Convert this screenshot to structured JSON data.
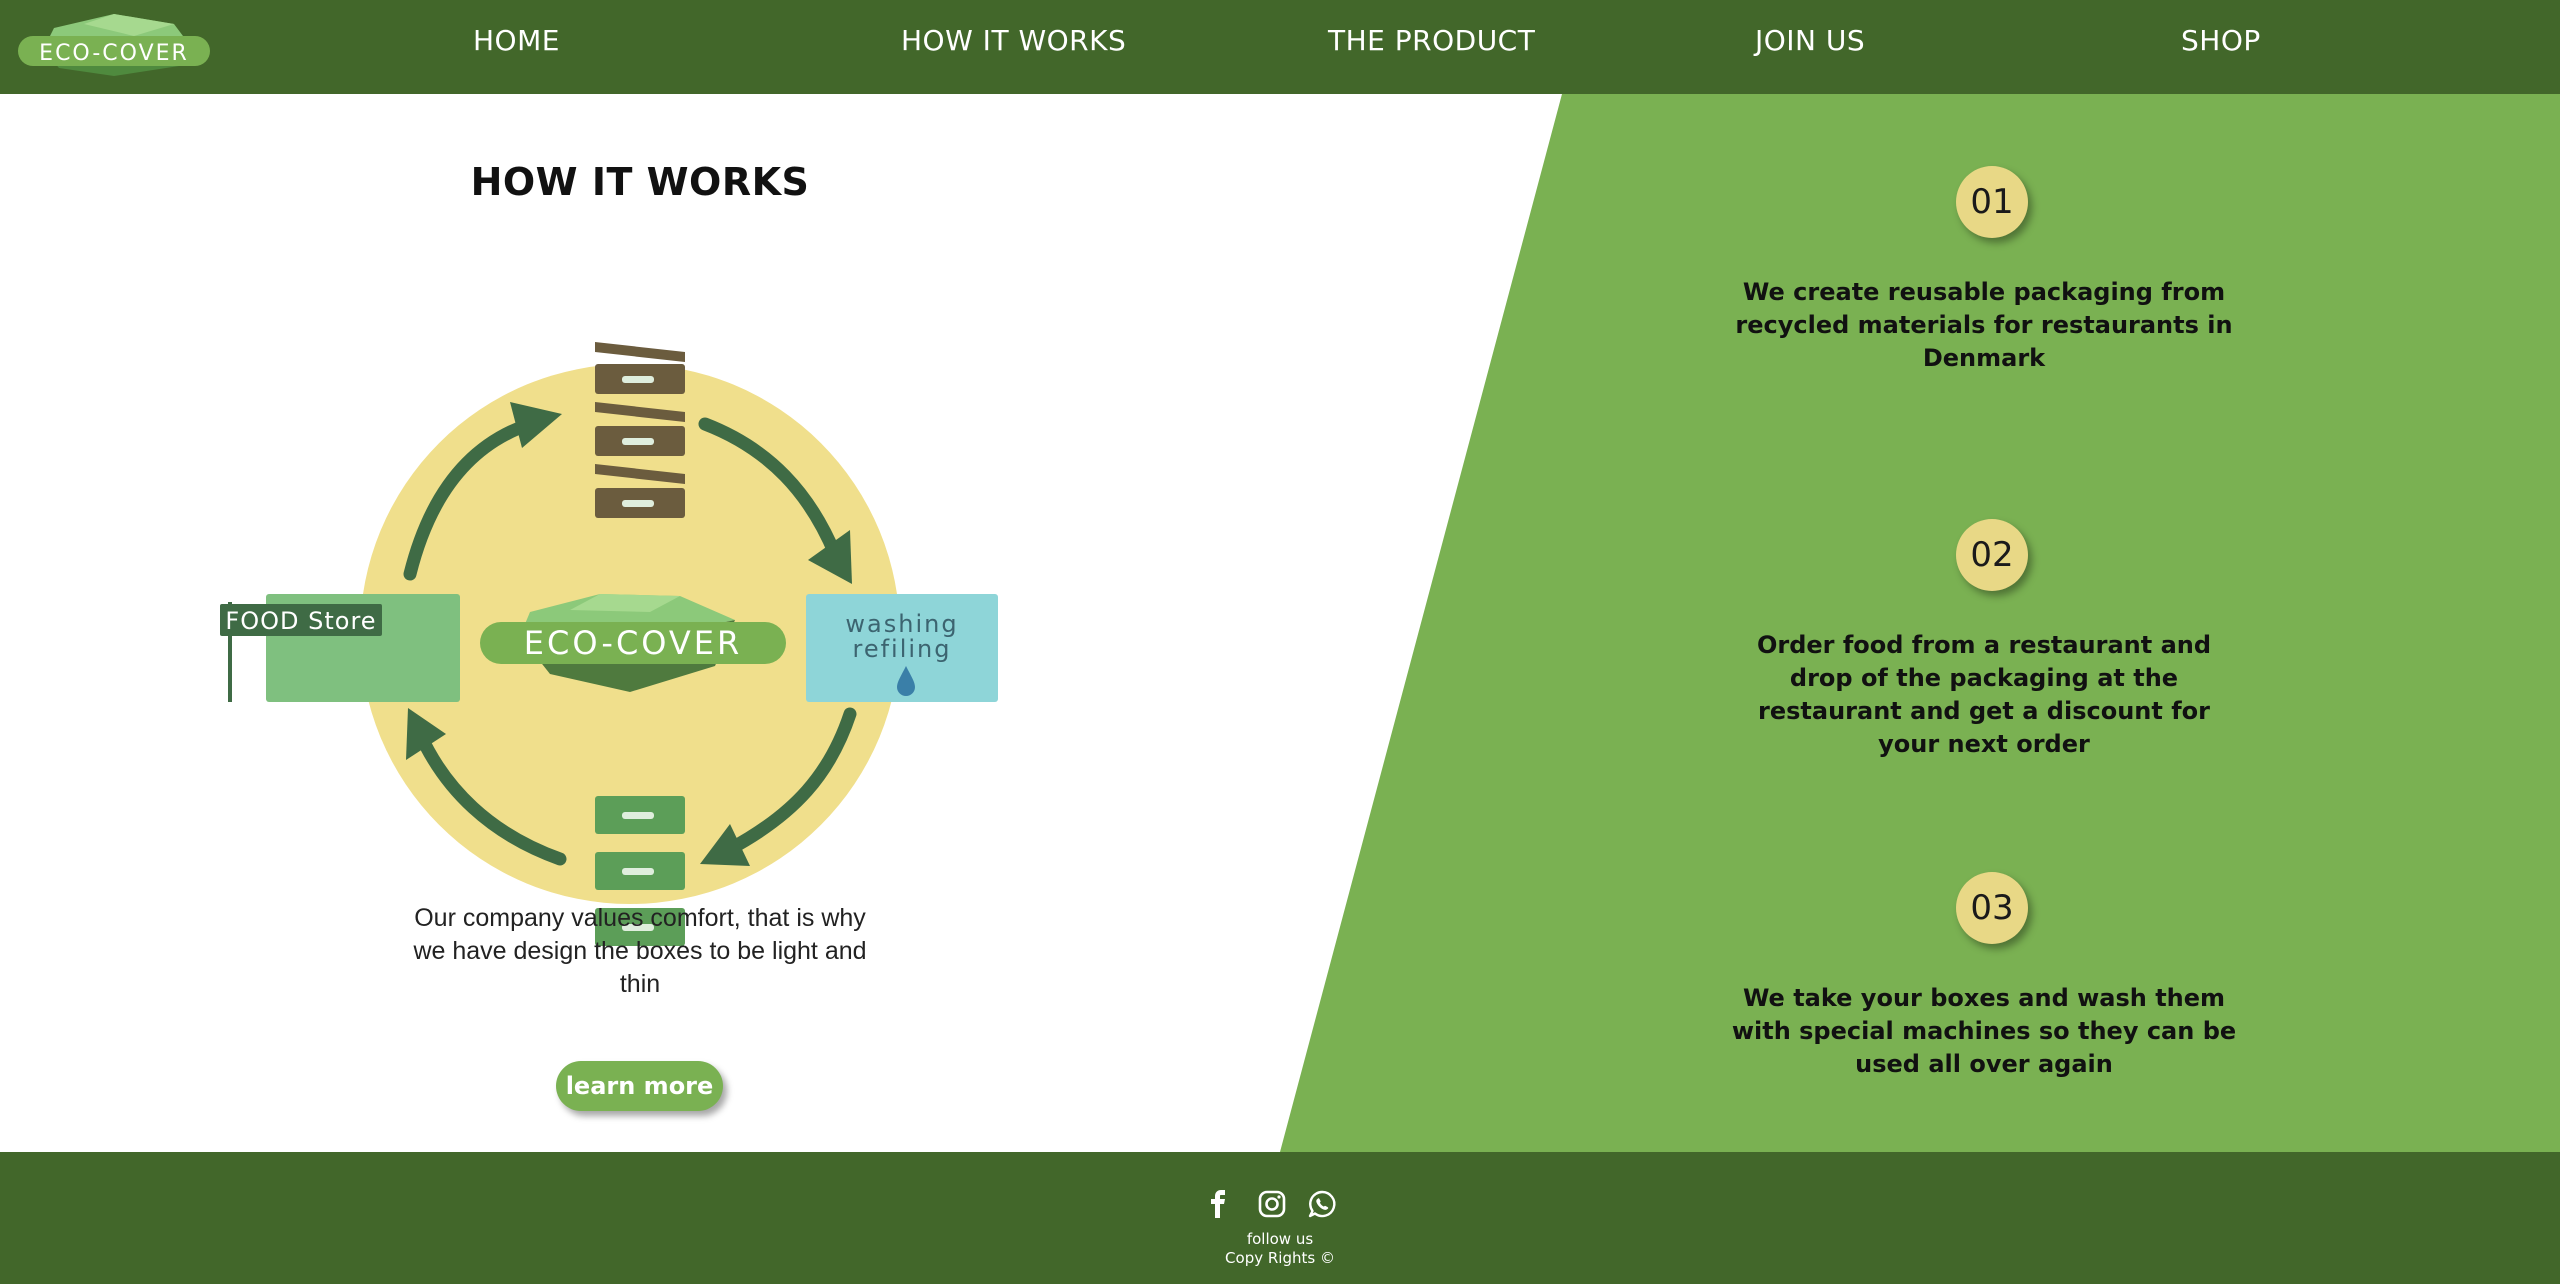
{
  "brand": {
    "logo_text": "ECO-COVER"
  },
  "nav": {
    "items": [
      {
        "label": "HOME"
      },
      {
        "label": "HOW IT WORKS"
      },
      {
        "label": "THE PRODUCT"
      },
      {
        "label": "JOIN US"
      },
      {
        "label": "SHOP"
      }
    ]
  },
  "how_it_works": {
    "title": "HOW IT WORKS",
    "diagram": {
      "food_store_label": "FOOD Store",
      "center_label": "ECO-COVER",
      "washing_line1": "washing",
      "washing_line2": "refiling"
    },
    "values_text": "Our company values comfort, that is why we have design the boxes to be light and thin",
    "learn_more_label": "learn more"
  },
  "steps": [
    {
      "number": "01",
      "text": "We create reusable packaging from recycled materials for restaurants in Denmark"
    },
    {
      "number": "02",
      "text": "Order food from a restaurant and drop of the packaging at the restaurant and get a discount for your next order"
    },
    {
      "number": "03",
      "text": "We take your boxes and wash them with special machines so they can be used all over again"
    }
  ],
  "footer": {
    "social_icons": [
      "facebook-icon",
      "instagram-icon",
      "whatsapp-icon"
    ],
    "follow_label": "follow us",
    "copyright": "Copy Rights ©"
  },
  "colors": {
    "nav_bg": "#42672a",
    "accent_green": "#7ab152",
    "badge_yellow": "#e8d886",
    "circle_yellow": "#f0df8c",
    "arrow_green": "#3f6b45",
    "washing_blue": "#8ed5d8",
    "food_store_green": "#7fc07f"
  }
}
